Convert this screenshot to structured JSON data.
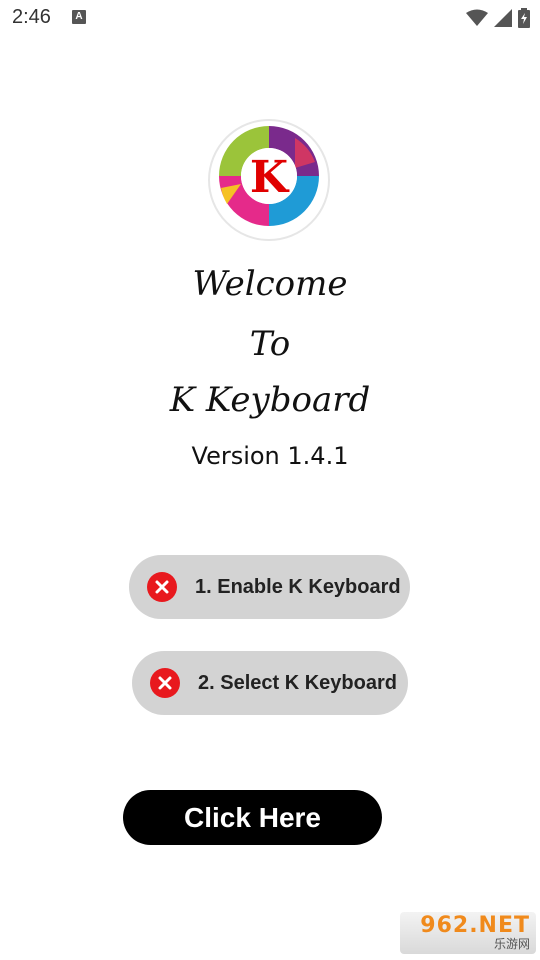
{
  "status_bar": {
    "time": "2:46",
    "notification_icon": "A"
  },
  "logo": {
    "letter": "K"
  },
  "welcome": {
    "line1": "Welcome",
    "line2": "To",
    "line3": "K Keyboard",
    "version": "Version 1.4.1"
  },
  "steps": [
    {
      "label": "1. Enable K Keyboard",
      "status_icon": "x-icon",
      "status_color": "#e8191e"
    },
    {
      "label": "2. Select K Keyboard",
      "status_icon": "x-icon",
      "status_color": "#e8191e"
    }
  ],
  "action": {
    "label": "Click Here"
  },
  "watermark": {
    "main": "962.NET",
    "sub": "乐游网"
  }
}
